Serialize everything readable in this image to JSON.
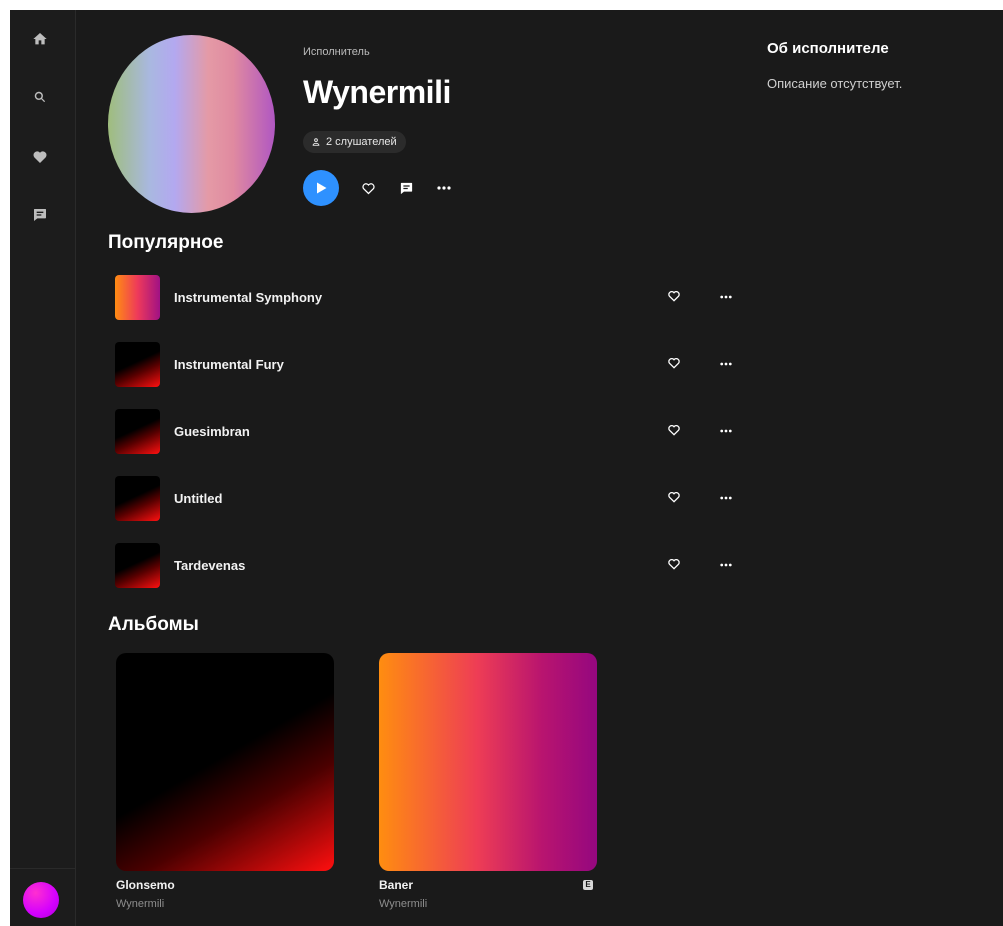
{
  "sidebar": {
    "items": [
      {
        "icon": "home-icon"
      },
      {
        "icon": "search-icon"
      },
      {
        "icon": "heart-icon"
      },
      {
        "icon": "chat-icon"
      }
    ]
  },
  "artist": {
    "type_label": "Исполнитель",
    "name": "Wynermili",
    "listeners": "2 слушателей"
  },
  "about": {
    "title": "Об исполнителе",
    "text": "Описание отсутствует."
  },
  "popular": {
    "title": "Популярное",
    "tracks": [
      {
        "title": "Instrumental Symphony",
        "cover": "orange"
      },
      {
        "title": "Instrumental Fury",
        "cover": "dark"
      },
      {
        "title": "Guesimbran",
        "cover": "dark"
      },
      {
        "title": "Untitled",
        "cover": "dark"
      },
      {
        "title": "Tardevenas",
        "cover": "dark"
      }
    ]
  },
  "albums": {
    "title": "Альбомы",
    "items": [
      {
        "title": "Glonsemo",
        "artist": "Wynermili",
        "explicit": false
      },
      {
        "title": "Baner",
        "artist": "Wynermili",
        "explicit": true,
        "badge": "E"
      }
    ]
  },
  "colors": {
    "background": "#1a1a1a",
    "accent": "#2e91ff",
    "muted_text": "#8e8e8e"
  }
}
